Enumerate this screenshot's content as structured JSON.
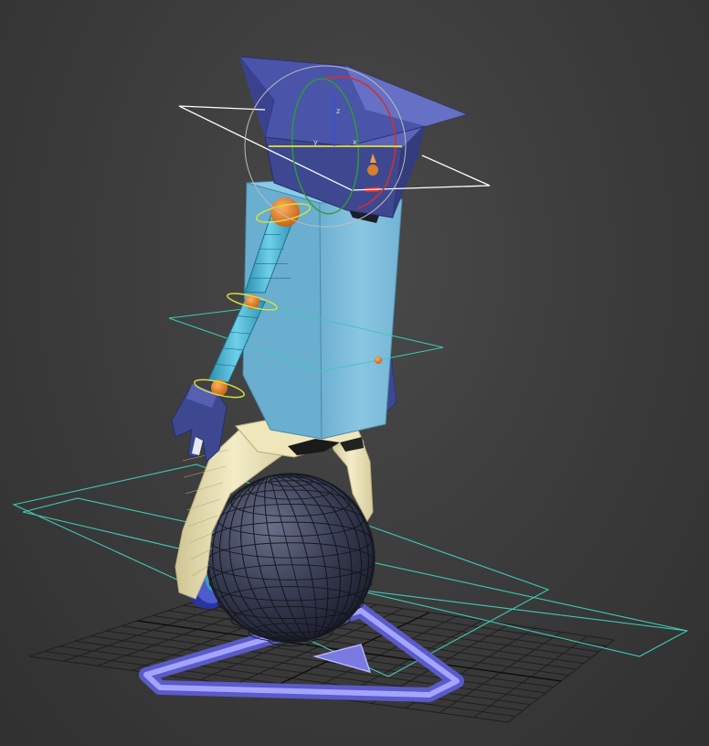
{
  "viewport": {
    "background_color": "#3c3c3c",
    "grid_color": "#1f1f1f",
    "shading": "wireframe-over-shaded"
  },
  "colors": {
    "hat": "#4a54a8",
    "hat_light": "#6670c4",
    "torso": "#79b9d8",
    "torso_dark": "#5a9bbd",
    "arm": "#4fb0cc",
    "joint": "#e0852c",
    "hand": "#3e4890",
    "legs": "#e8dfb2",
    "ball": "#383c52",
    "wheel": "#4a5cc8",
    "control_triangle": "#8c8cf0",
    "helper_outline": "#3fc9b4",
    "white_helper": "#ffffff",
    "yellow_helper": "#d6e040"
  },
  "gizmo": {
    "axis_x": "x",
    "axis_y": "y",
    "axis_z": "z",
    "axis_x_color": "#e04040",
    "axis_y_color": "#40c040",
    "axis_z_color": "#4060e0"
  },
  "icons": {
    "rotate_gizmo": "rotate-gizmo-icon"
  }
}
